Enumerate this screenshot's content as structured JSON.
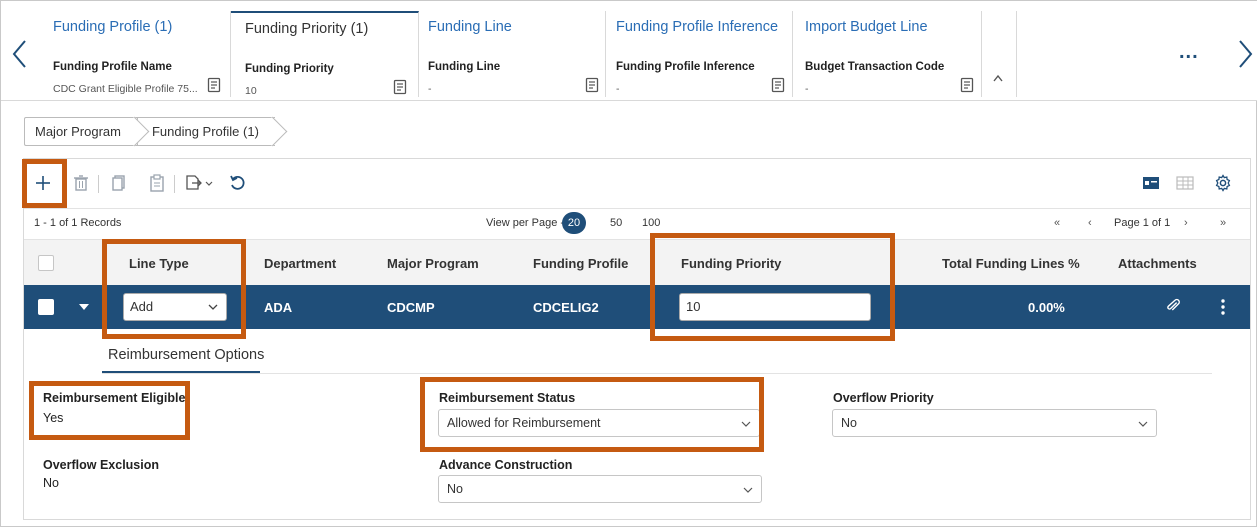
{
  "tabs": [
    {
      "title": "Funding Profile (1)",
      "field_label": "Funding Profile Name",
      "field_value": "CDC Grant Eligible Profile 75..."
    },
    {
      "title": "Funding Priority (1)",
      "field_label": "Funding Priority",
      "field_value": "10"
    },
    {
      "title": "Funding Line",
      "field_label": "Funding Line",
      "field_value": "-"
    },
    {
      "title": "Funding Profile Inference",
      "field_label": "Funding Profile Inference",
      "field_value": "-"
    },
    {
      "title": "Import Budget Line",
      "field_label": "Budget Transaction Code",
      "field_value": "-"
    }
  ],
  "more": "...",
  "breadcrumb": [
    "Major Program",
    "Funding Profile (1)"
  ],
  "paging": {
    "records": "1 - 1 of 1 Records",
    "view_per_page": "View per Page -",
    "options": [
      "20",
      "50",
      "100"
    ],
    "page": "Page 1 of 1",
    "first": "«",
    "prev": "‹",
    "next": "›",
    "last": "»"
  },
  "table": {
    "headers": [
      "Line Type",
      "Department",
      "Major Program",
      "Funding Profile",
      "Funding Priority",
      "Total Funding Lines %",
      "Attachments"
    ],
    "row": {
      "line_type": "Add",
      "department": "ADA",
      "major_program": "CDCMP",
      "funding_profile": "CDCELIG2",
      "funding_priority": "10",
      "total_funding_lines": "0.00%"
    }
  },
  "detail": {
    "tab": "Reimbursement Options",
    "reimbursement_eligible_label": "Reimbursement Eligible",
    "reimbursement_eligible_value": "Yes",
    "reimbursement_status_label": "Reimbursement Status",
    "reimbursement_status_value": "Allowed for Reimbursement",
    "overflow_priority_label": "Overflow Priority",
    "overflow_priority_value": "No",
    "overflow_exclusion_label": "Overflow Exclusion",
    "overflow_exclusion_value": "No",
    "advance_construction_label": "Advance Construction",
    "advance_construction_value": "No"
  },
  "colors": {
    "primary": "#1f4e79",
    "link": "#2a6db5",
    "highlight": "#c55a11"
  }
}
